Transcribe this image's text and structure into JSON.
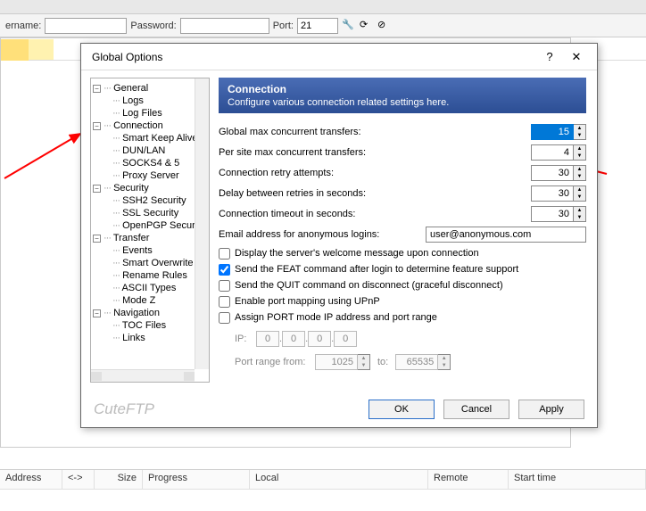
{
  "credbar": {
    "username_label": "ername:",
    "username_value": "",
    "password_label": "Password:",
    "password_value": "",
    "port_label": "Port:",
    "port_value": "21"
  },
  "dialog": {
    "title": "Global Options",
    "help": "?",
    "close": "✕",
    "brand": "CuteFTP",
    "buttons": {
      "ok": "OK",
      "cancel": "Cancel",
      "apply": "Apply"
    }
  },
  "tree": {
    "general": "General",
    "logs": "Logs",
    "log_files": "Log Files",
    "connection": "Connection",
    "smart_keep_alive": "Smart Keep Alive",
    "dun_lan": "DUN/LAN",
    "socks": "SOCKS4 & 5",
    "proxy": "Proxy Server",
    "security": "Security",
    "ssh2": "SSH2 Security",
    "ssl": "SSL Security",
    "openpgp": "OpenPGP Security",
    "transfer": "Transfer",
    "events": "Events",
    "smart_overwrite": "Smart Overwrite",
    "rename": "Rename Rules",
    "ascii": "ASCII Types",
    "modez": "Mode Z",
    "navigation": "Navigation",
    "toc": "TOC Files",
    "links": "Links"
  },
  "section": {
    "title": "Connection",
    "desc": "Configure various connection related settings here."
  },
  "fields": {
    "global_max": {
      "label": "Global max concurrent transfers:",
      "value": "15"
    },
    "per_site_max": {
      "label": "Per site max concurrent transfers:",
      "value": "4"
    },
    "retry": {
      "label": "Connection retry attempts:",
      "value": "30"
    },
    "delay": {
      "label": "Delay between retries in seconds:",
      "value": "30"
    },
    "timeout": {
      "label": "Connection timeout in seconds:",
      "value": "30"
    },
    "email": {
      "label": "Email address for anonymous logins:",
      "value": "user@anonymous.com"
    }
  },
  "checks": {
    "welcome": "Display the server's welcome message upon connection",
    "feat": "Send the FEAT command after login to determine feature support",
    "quit": "Send the QUIT command on disconnect (graceful disconnect)",
    "upnp": "Enable port mapping using UPnP",
    "portmode": "Assign PORT mode IP address and port range"
  },
  "portblock": {
    "ip_label": "IP:",
    "ip": [
      "0",
      "0",
      "0",
      "0"
    ],
    "range_label": "Port range from:",
    "from": "1025",
    "to_label": "to:",
    "to": "65535"
  },
  "grid": {
    "address": "Address",
    "dir": "<->",
    "size": "Size",
    "progress": "Progress",
    "local": "Local",
    "remote": "Remote",
    "start": "Start time"
  }
}
